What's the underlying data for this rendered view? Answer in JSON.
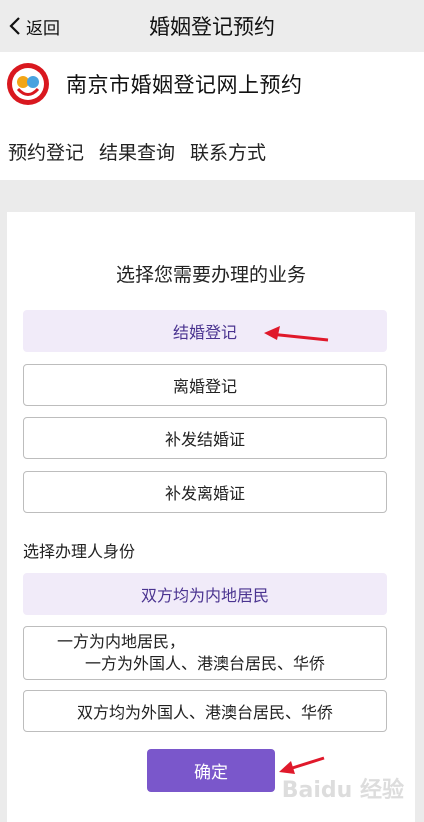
{
  "nav": {
    "back_label": "返回",
    "title": "婚姻登记预约"
  },
  "site": {
    "title": "南京市婚姻登记网上预约",
    "logo_icon": "marriage-registration-logo"
  },
  "menu": {
    "items": [
      "预约登记",
      "结果查询",
      "联系方式"
    ]
  },
  "business": {
    "title": "选择您需要办理的业务",
    "options": [
      "结婚登记",
      "离婚登记",
      "补发结婚证",
      "补发离婚证"
    ],
    "selected": "结婚登记"
  },
  "identity": {
    "label": "选择办理人身份",
    "options": [
      "双方均为内地居民",
      "一方为内地居民，",
      "一方为外国人、港澳台居民、华侨",
      "双方均为外国人、港澳台居民、华侨"
    ],
    "selected": "双方均为内地居民"
  },
  "confirm_label": "确定",
  "colors": {
    "accent": "#7a57cb",
    "selected_bg": "#f1ebf9",
    "arrow": "#e0192b"
  },
  "watermark": "Baidu 经验"
}
